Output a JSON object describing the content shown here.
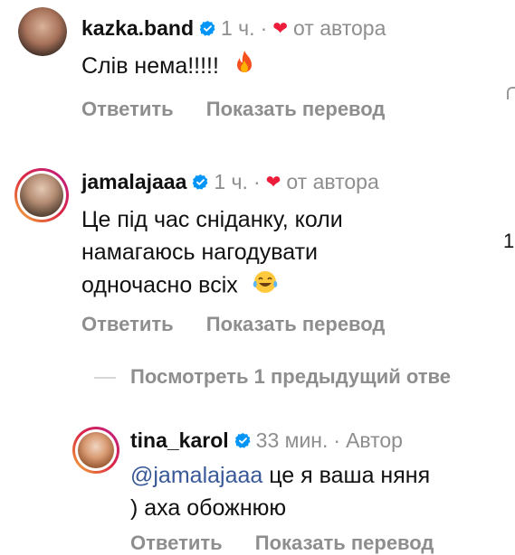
{
  "comments": [
    {
      "username": "kazka.band",
      "time": "1 ч.",
      "author_label": "от автора",
      "text": "Слів нема!!!!!",
      "emoji": "fire-emoji",
      "reply_label": "Ответить",
      "translate_label": "Показать перевод"
    },
    {
      "username": "jamalajaaa",
      "time": "1 ч.",
      "author_label": "от автора",
      "text_lines": [
        "Це під час сніданку, коли",
        "намагаюсь нагодувати",
        "одночасно всіх"
      ],
      "emoji": "tears-of-joy-emoji",
      "likes": "1",
      "reply_label": "Ответить",
      "translate_label": "Показать перевод"
    }
  ],
  "view_previous": "Посмотреть 1 предыдущий отве",
  "reply": {
    "username": "tina_karol",
    "time": "33 мин.",
    "author_label": "Автор",
    "mention": "@jamalajaaa",
    "text_line1": " це я ваша няня",
    "text_line2": ") аха обожнюю",
    "partial_reply_label": "Ответить",
    "partial_translate_label": "Показать перевод"
  },
  "separator": "·",
  "colors": {
    "accent": "#0095f6",
    "muted": "#8e8e8e",
    "heart": "#ed1c3a",
    "mention": "#385898"
  }
}
